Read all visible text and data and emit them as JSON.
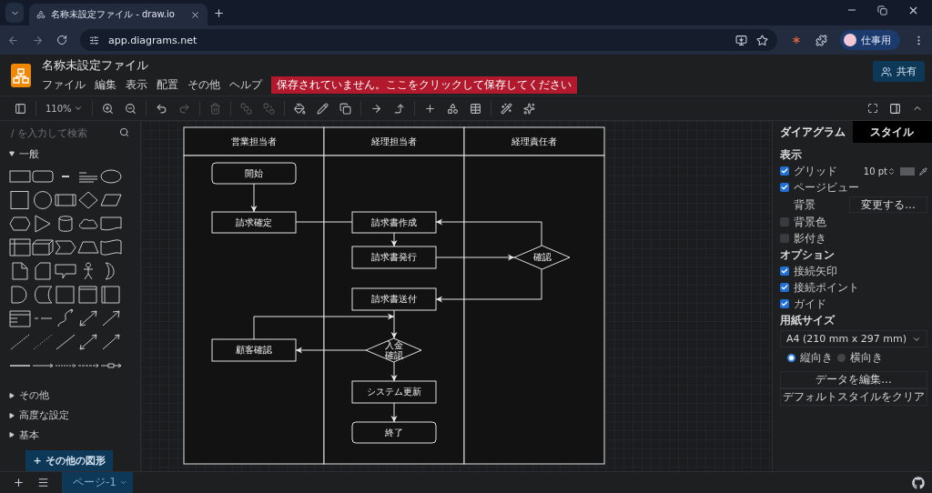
{
  "browser": {
    "tabs": [
      {
        "title": "名称未設定ファイル - draw.io",
        "selected": true
      }
    ],
    "address": "app.diagrams.net",
    "profile": "仕事用"
  },
  "app": {
    "title": "名称未設定ファイル",
    "menus": [
      "ファイル",
      "編集",
      "表示",
      "配置",
      "その他",
      "ヘルプ"
    ],
    "unsaved_notice": "保存されていません。ここをクリックして保存してください",
    "share": "共有"
  },
  "toolbar": {
    "zoom": "110%",
    "tool_groups": [
      [
        {
          "kind": "sidebar",
          "disabled": false
        }
      ],
      [
        {
          "kind": "zoom",
          "disabled": false
        }
      ],
      [
        {
          "kind": "zoom-in",
          "disabled": false
        },
        {
          "kind": "zoom-out",
          "disabled": false
        }
      ],
      [
        {
          "kind": "undo",
          "disabled": false
        },
        {
          "kind": "redo",
          "disabled": true
        }
      ],
      [
        {
          "kind": "delete",
          "disabled": true
        }
      ],
      [
        {
          "kind": "to-front",
          "disabled": true
        },
        {
          "kind": "to-back",
          "disabled": true
        }
      ],
      [
        {
          "kind": "fill",
          "disabled": false
        },
        {
          "kind": "line",
          "disabled": false
        },
        {
          "kind": "shadow",
          "disabled": false
        }
      ],
      [
        {
          "kind": "connection",
          "disabled": false
        },
        {
          "kind": "waypoint",
          "disabled": false
        }
      ],
      [
        {
          "kind": "insert",
          "disabled": false
        },
        {
          "kind": "shapes",
          "disabled": false
        },
        {
          "kind": "table",
          "disabled": false
        }
      ],
      [
        {
          "kind": "edit-style",
          "disabled": false
        },
        {
          "kind": "sparkle",
          "disabled": false
        }
      ]
    ]
  },
  "sidebar": {
    "search": {
      "placeholder": "/ を入力して検索"
    },
    "sections": [
      {
        "label": "一般",
        "expanded": true
      },
      {
        "label": "その他",
        "expanded": false
      },
      {
        "label": "高度な設定",
        "expanded": false
      },
      {
        "label": "基本",
        "expanded": false
      }
    ],
    "more_shapes": "+ その他の図形"
  },
  "diagram": {
    "lanes": [
      "営業担当者",
      "経理担当者",
      "経理責任者"
    ],
    "nodes": [
      {
        "label": "開始",
        "kind": "terminal"
      },
      {
        "label": "請求確定",
        "kind": "process"
      },
      {
        "label": "請求書作成",
        "kind": "process"
      },
      {
        "label": "請求書発行",
        "kind": "process"
      },
      {
        "label": "確認",
        "kind": "decision"
      },
      {
        "label": "請求書送付",
        "kind": "process"
      },
      {
        "label": "入金確認",
        "kind": "decision"
      },
      {
        "label": "顧客確認",
        "kind": "process"
      },
      {
        "label": "システム更新",
        "kind": "process"
      },
      {
        "label": "終了",
        "kind": "terminal"
      }
    ]
  },
  "format_panel": {
    "tabs": [
      {
        "label": "ダイアグラム",
        "selected": true
      },
      {
        "label": "スタイル",
        "selected": false
      }
    ],
    "view_heading": "表示",
    "view_options": [
      {
        "label": "グリッド",
        "checked": true
      },
      {
        "label": "ページビュー",
        "checked": true
      }
    ],
    "grid_size": "10 pt",
    "background": {
      "label": "背景",
      "button": "変更する..."
    },
    "style_options": [
      {
        "label": "背景色",
        "checked": false
      },
      {
        "label": "影付き",
        "checked": false
      }
    ],
    "options_heading": "オプション",
    "options": [
      {
        "label": "接続矢印",
        "checked": true
      },
      {
        "label": "接続ポイント",
        "checked": true
      },
      {
        "label": "ガイド",
        "checked": true
      }
    ],
    "paper_heading": "用紙サイズ",
    "paper_size": "A4 (210 mm x 297 mm)",
    "orientations": [
      {
        "label": "縦向き",
        "selected": true
      },
      {
        "label": "横向き",
        "selected": false
      }
    ],
    "buttons": [
      "データを編集...",
      "デフォルトスタイルをクリア"
    ]
  },
  "pages": [
    {
      "label": "ページ-1",
      "selected": true
    }
  ]
}
